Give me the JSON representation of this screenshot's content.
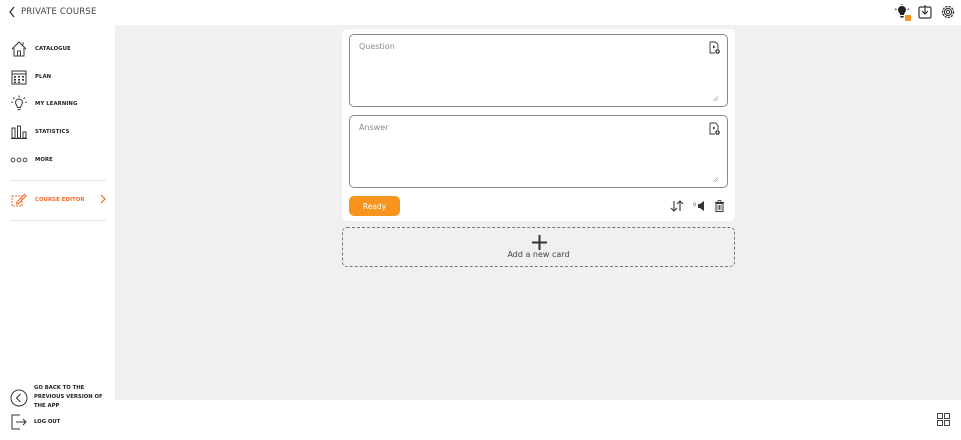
{
  "header": {
    "back_label": "PRIVATE COURSE",
    "icons": [
      "lightbulb-icon",
      "download-icon",
      "gear-icon"
    ]
  },
  "sidebar": {
    "items": [
      {
        "label": "CATALOGUE",
        "icon": "home-icon"
      },
      {
        "label": "PLAN",
        "icon": "calendar-icon"
      },
      {
        "label": "MY LEARNING",
        "icon": "lightbulb-icon"
      },
      {
        "label": "STATISTICS",
        "icon": "bar-chart-icon"
      },
      {
        "label": "MORE",
        "icon": "more-icon"
      },
      {
        "label": "COURSE EDITOR",
        "icon": "edit-icon",
        "active": true
      }
    ],
    "bottom": {
      "previous_version_label": "GO BACK TO THE PREVIOUS VERSION OF THE APP",
      "logout_label": "LOG OUT"
    }
  },
  "card": {
    "question_placeholder": "Question",
    "answer_placeholder": "Answer",
    "ready_label": "Ready",
    "sound_count": "0"
  },
  "add_card": {
    "label": "Add a new card"
  },
  "colors": {
    "accent": "#f7941d",
    "active_text": "#f26722",
    "background": "#f0f0f0"
  }
}
